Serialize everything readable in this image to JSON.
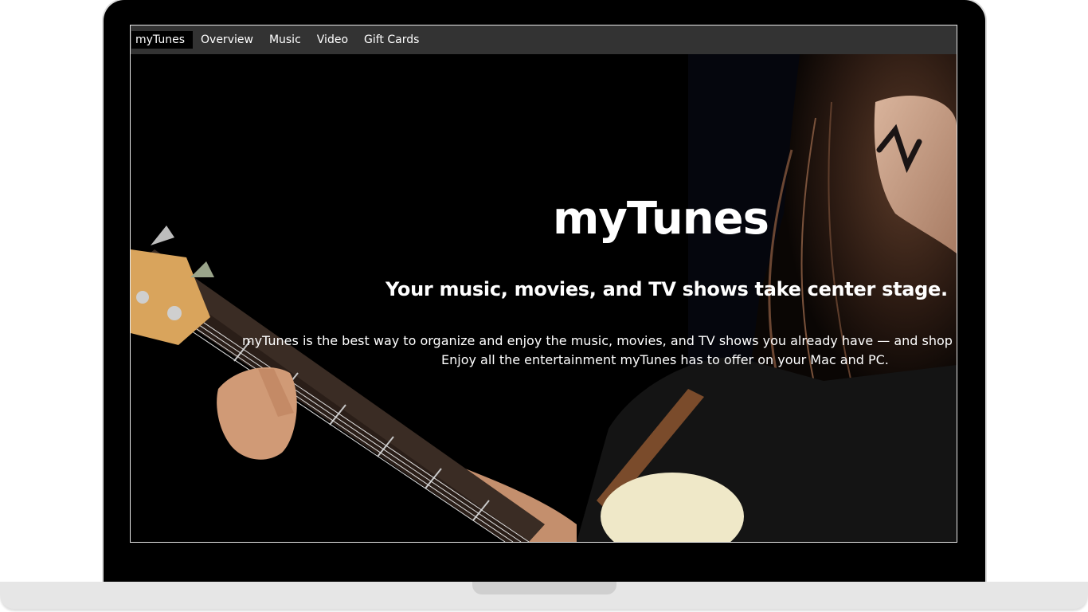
{
  "nav": {
    "items": [
      {
        "label": "myTunes",
        "active": true
      },
      {
        "label": "Overview",
        "active": false
      },
      {
        "label": "Music",
        "active": false
      },
      {
        "label": "Video",
        "active": false
      },
      {
        "label": "Gift Cards",
        "active": false
      }
    ]
  },
  "hero": {
    "title": "myTunes",
    "subtitle": "Your music, movies, and TV shows take center stage.",
    "description_line1": "myTunes is the best way to organize and enjoy the music, movies, and TV shows you already have — and shop for",
    "description_line2": "Enjoy all the entertainment myTunes has to offer on your Mac and PC."
  },
  "colors": {
    "navbar_bg": "#333333",
    "active_tab_bg": "#000000",
    "hero_bg": "#000000",
    "text": "#ffffff",
    "laptop_bezel": "#000000",
    "laptop_base": "#e6e6e6"
  }
}
